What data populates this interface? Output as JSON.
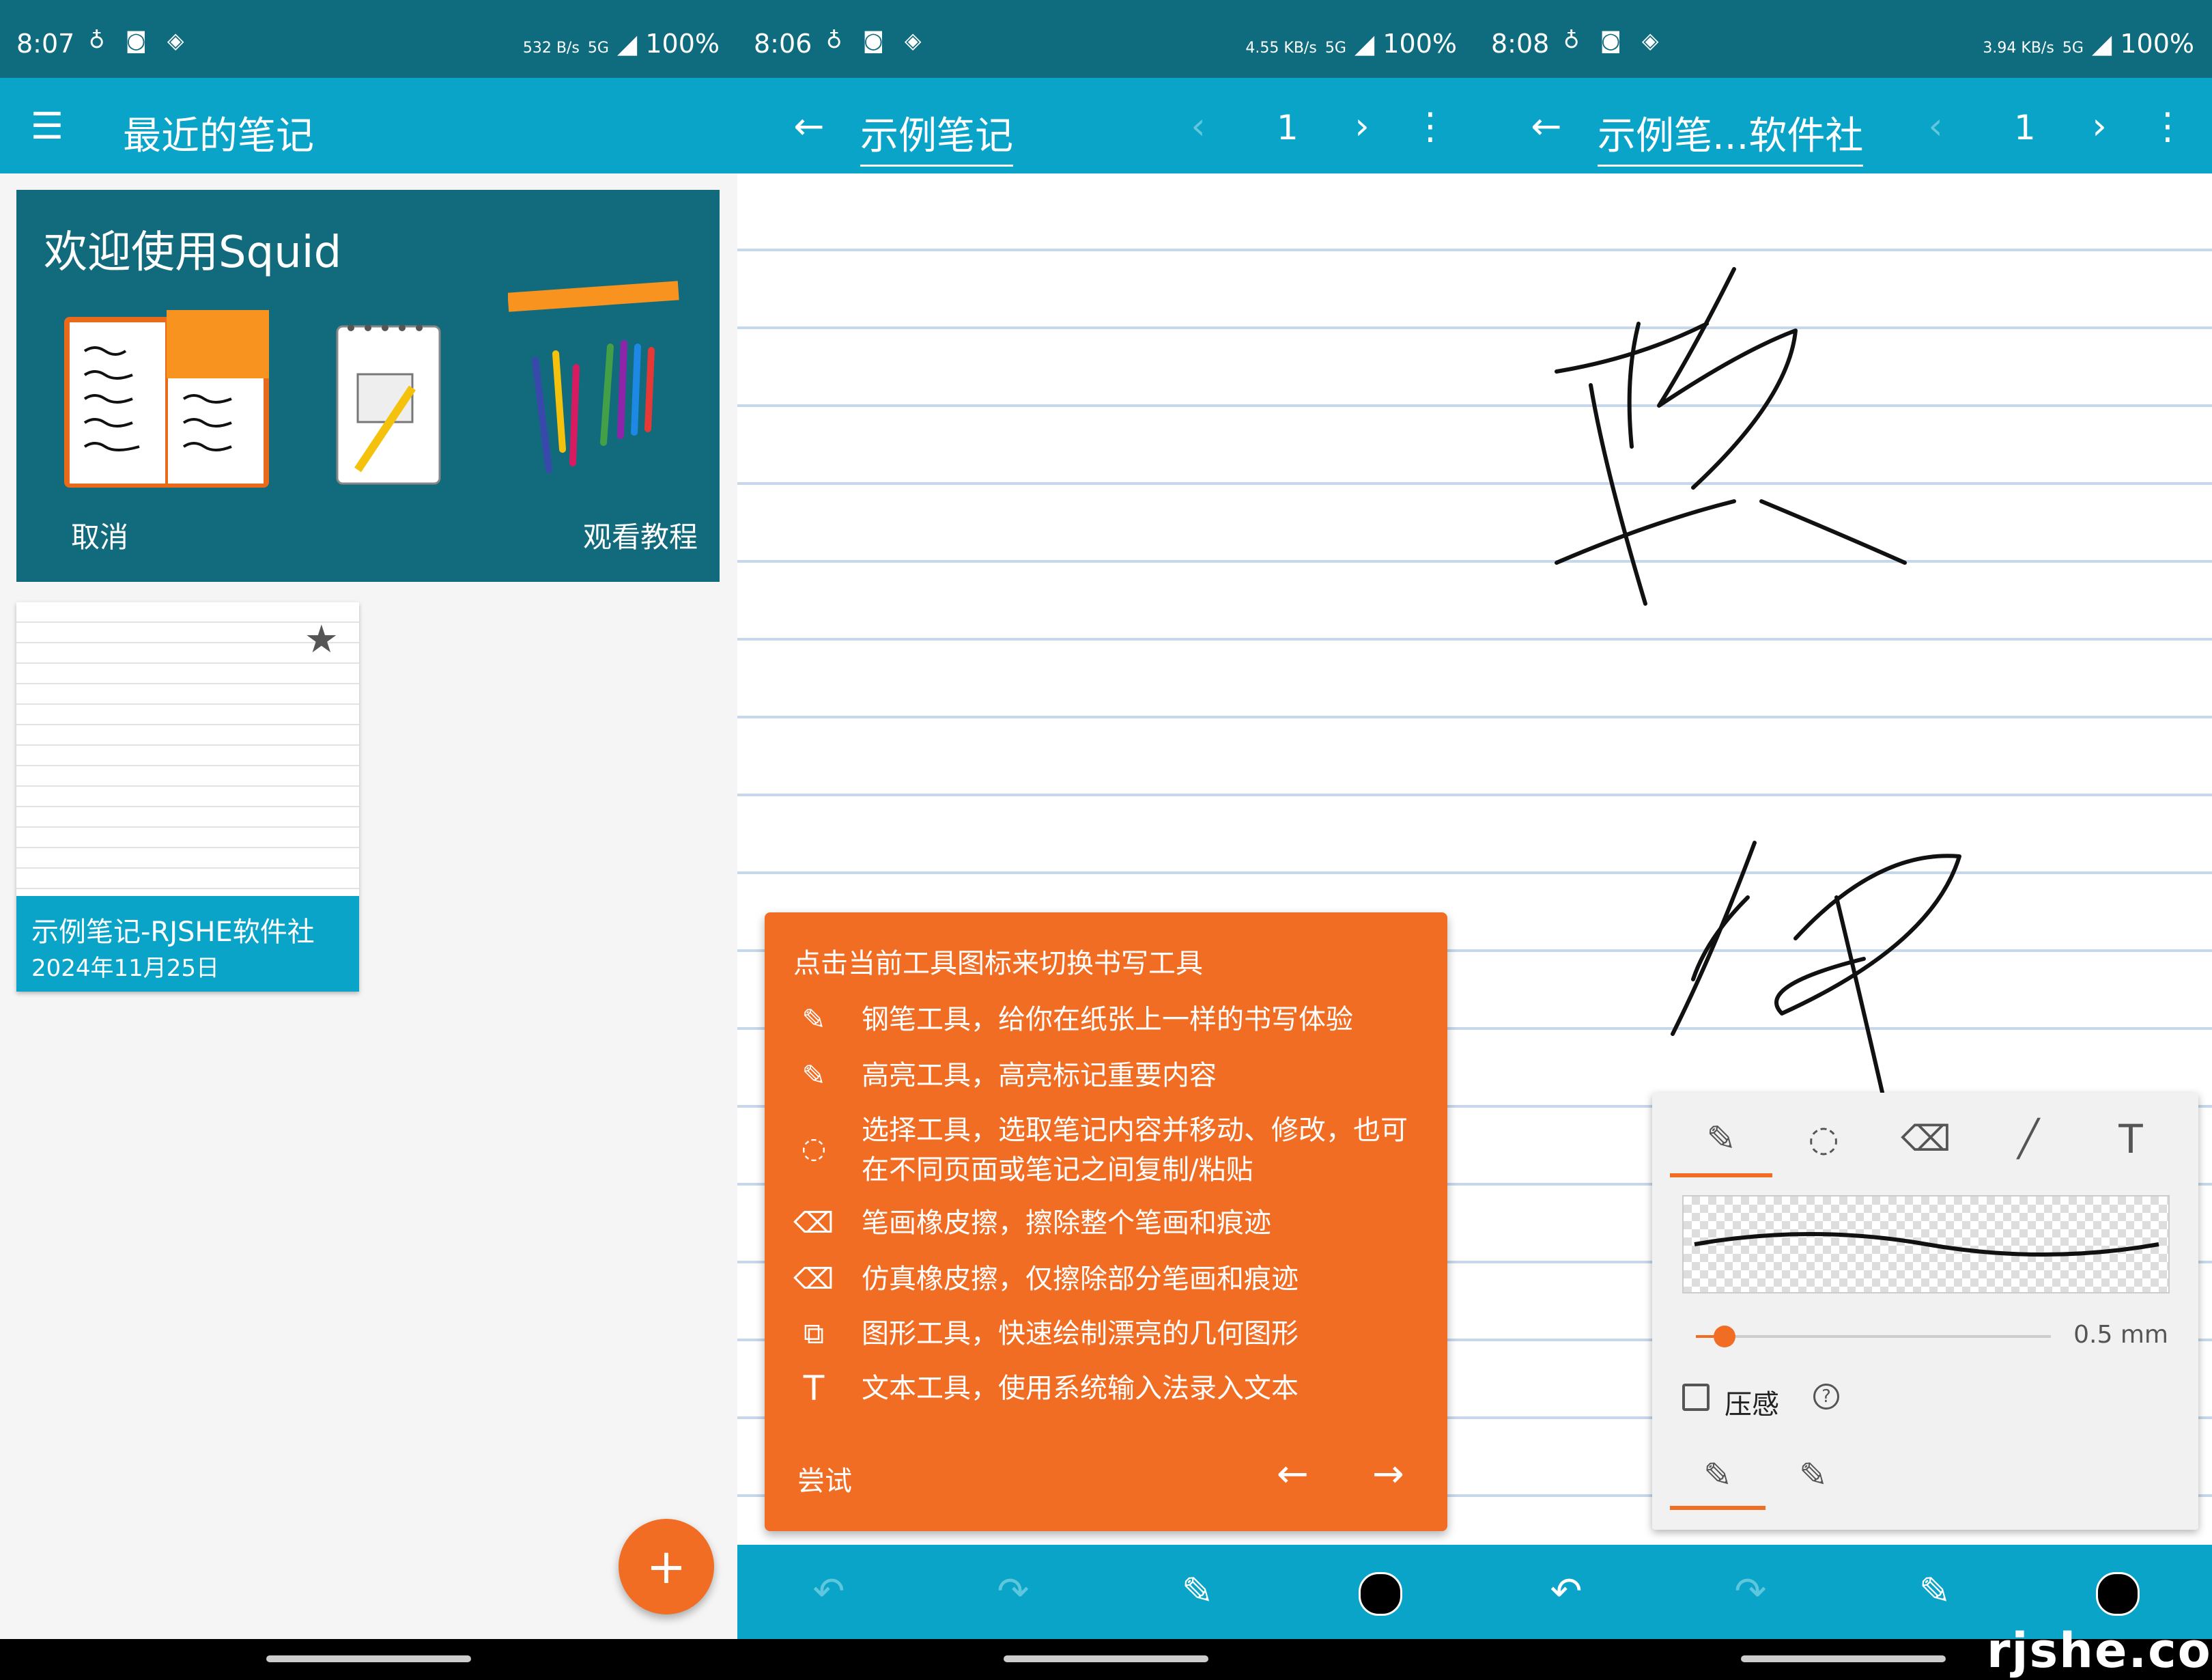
{
  "panel1": {
    "status": {
      "time": "8:07",
      "left_icons": "♁ ◙ ◈",
      "speed": "532 B/s",
      "network": "5G",
      "battery": "100%"
    },
    "appbar": {
      "title": "最近的笔记",
      "menu_icon": "menu-icon"
    },
    "welcome": {
      "title": "欢迎使用Squid",
      "cancel": "取消",
      "tutorial": "观看教程"
    },
    "note": {
      "title": "示例笔记-RJSHE软件社",
      "date": "2024年11月25日",
      "starred": true
    },
    "fab": {
      "label": "+"
    }
  },
  "panel2": {
    "status": {
      "time": "8:06",
      "left_icons": "♁ ◙ ◈",
      "speed": "4.55 KB/s",
      "network": "5G",
      "battery": "100%"
    },
    "appbar": {
      "title": "示例笔记",
      "page": "1"
    },
    "tutorial": {
      "heading": "点击当前工具图标来切换书写工具",
      "items": [
        {
          "icon": "pen-icon",
          "text": "钢笔工具，给你在纸张上一样的书写体验"
        },
        {
          "icon": "highlighter-icon",
          "text": "高亮工具，高亮标记重要内容"
        },
        {
          "icon": "lasso-icon",
          "text": "选择工具，选取笔记内容并移动、修改，也可在不同页面或笔记之间复制/粘贴"
        },
        {
          "icon": "stroke-eraser-icon",
          "text": "笔画橡皮擦，擦除整个笔画和痕迹"
        },
        {
          "icon": "partial-eraser-icon",
          "text": "仿真橡皮擦，仅擦除部分笔画和痕迹"
        },
        {
          "icon": "shape-icon",
          "text": "图形工具，快速绘制漂亮的几何图形"
        },
        {
          "icon": "text-icon",
          "text": "文本工具，使用系统输入法录入文本"
        }
      ],
      "try_label": "尝试"
    }
  },
  "panel3": {
    "status": {
      "time": "8:08",
      "left_icons": "♁ ◙ ◈",
      "speed": "3.94 KB/s",
      "network": "5G",
      "battery": "100%"
    },
    "appbar": {
      "title": "示例笔...软件社",
      "page": "1"
    },
    "pen_panel": {
      "size_label": "0.5 mm",
      "size_fraction": 0.05,
      "pressure_label": "压感",
      "pressure_checked": false
    },
    "colors": {
      "accent": "#f26d24",
      "bar": "#0aa4c8",
      "status": "#0e6c7e"
    }
  },
  "watermark": "rjshe.com"
}
